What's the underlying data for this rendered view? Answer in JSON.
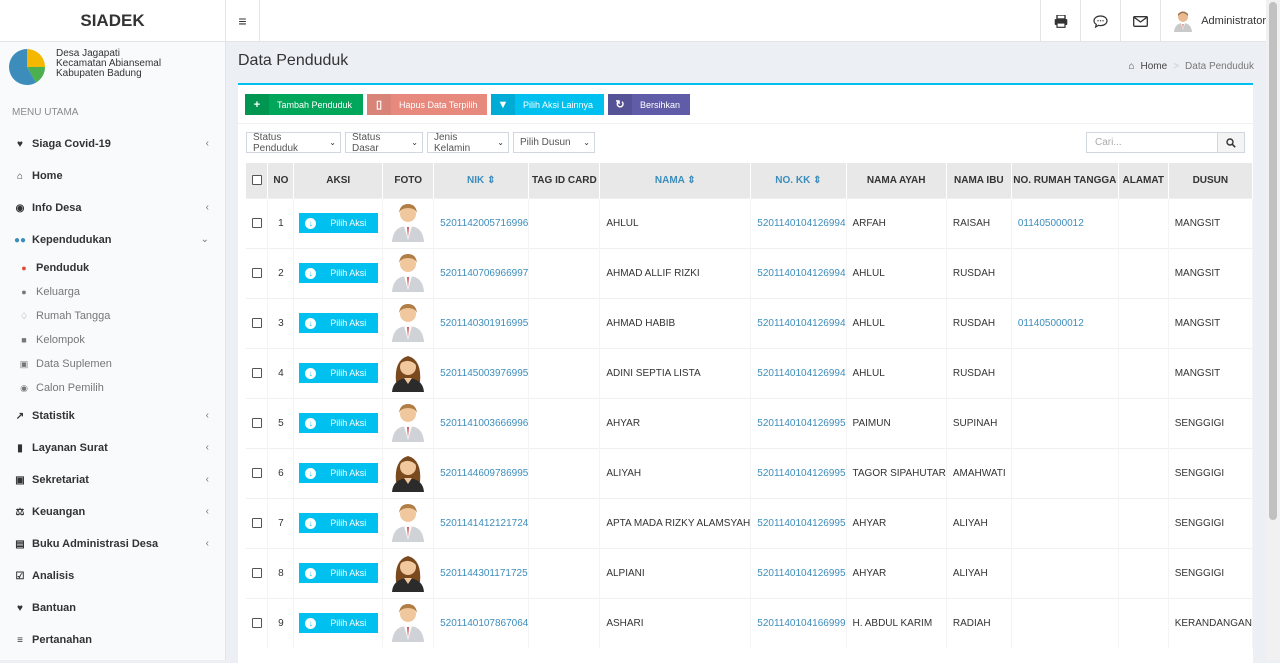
{
  "app": {
    "brand": "SIADEK",
    "user": "Administrator"
  },
  "village": {
    "name": "Desa Jagapati",
    "kecamatan": "Kecamatan Abiansemal",
    "kabupaten": "Kabupaten Badung"
  },
  "sidebar": {
    "header": "MENU UTAMA",
    "items": [
      {
        "label": "Siaga Covid-19",
        "icon": "heartbeat-icon"
      },
      {
        "label": "Home",
        "icon": "home-icon"
      },
      {
        "label": "Info Desa",
        "icon": "info-icon"
      },
      {
        "label": "Kependudukan",
        "icon": "users-icon"
      }
    ],
    "subitems": [
      {
        "label": "Penduduk",
        "icon": "user-icon"
      },
      {
        "label": "Keluarga",
        "icon": "users-icon"
      },
      {
        "label": "Rumah Tangga",
        "icon": "handshake-icon"
      },
      {
        "label": "Kelompok",
        "icon": "sitemap-icon"
      },
      {
        "label": "Data Suplemen",
        "icon": "archive-icon"
      },
      {
        "label": "Calon Pemilih",
        "icon": "vote-icon"
      }
    ],
    "items2": [
      {
        "label": "Statistik",
        "icon": "chart-icon"
      },
      {
        "label": "Layanan Surat",
        "icon": "book-icon"
      },
      {
        "label": "Sekretariat",
        "icon": "archive-icon"
      },
      {
        "label": "Keuangan",
        "icon": "balance-icon"
      },
      {
        "label": "Buku Administrasi Desa",
        "icon": "paste-icon"
      },
      {
        "label": "Analisis",
        "icon": "check-icon"
      },
      {
        "label": "Bantuan",
        "icon": "heart-icon"
      },
      {
        "label": "Pertanahan",
        "icon": "map-icon"
      }
    ]
  },
  "page": {
    "title": "Data Penduduk",
    "breadcrumb_home": "Home",
    "breadcrumb_current": "Data Penduduk"
  },
  "buttons": {
    "tambah": "Tambah Penduduk",
    "hapus": "Hapus Data Terpilih",
    "pilih_aksi_lainnya": "Pilih Aksi Lainnya",
    "bersihkan": "Bersihkan"
  },
  "filters": [
    "Status Penduduk",
    "Status Dasar",
    "Jenis Kelamin",
    "Pilih Dusun"
  ],
  "search": {
    "placeholder": "Cari..."
  },
  "table": {
    "columns": [
      "NO",
      "AKSI",
      "FOTO",
      "NIK",
      "TAG ID CARD",
      "NAMA",
      "NO. KK",
      "NAMA AYAH",
      "NAMA IBU",
      "NO. RUMAH TANGGA",
      "ALAMAT",
      "DUSUN"
    ],
    "aksi_label": "Pilih Aksi",
    "rows": [
      {
        "no": "1",
        "gender": "m",
        "nik": "5201142005716996",
        "tag": "",
        "nama": "AHLUL",
        "kk": "5201140104126994",
        "ayah": "ARFAH",
        "ibu": "RAISAH",
        "rt": "011405000012",
        "alamat": "",
        "dusun": "MANGSIT"
      },
      {
        "no": "2",
        "gender": "m",
        "nik": "5201140706966997",
        "tag": "",
        "nama": "AHMAD ALLIF RIZKI",
        "kk": "5201140104126994",
        "ayah": "AHLUL",
        "ibu": "RUSDAH",
        "rt": "",
        "alamat": "",
        "dusun": "MANGSIT"
      },
      {
        "no": "3",
        "gender": "m",
        "nik": "5201140301916995",
        "tag": "",
        "nama": "AHMAD HABIB",
        "kk": "5201140104126994",
        "ayah": "AHLUL",
        "ibu": "RUSDAH",
        "rt": "011405000012",
        "alamat": "",
        "dusun": "MANGSIT"
      },
      {
        "no": "4",
        "gender": "f",
        "nik": "5201145003976995",
        "tag": "",
        "nama": "ADINI SEPTIA LISTA",
        "kk": "5201140104126994",
        "ayah": "AHLUL",
        "ibu": "RUSDAH",
        "rt": "",
        "alamat": "",
        "dusun": "MANGSIT"
      },
      {
        "no": "5",
        "gender": "m",
        "nik": "5201141003666996",
        "tag": "",
        "nama": "AHYAR",
        "kk": "5201140104126995",
        "ayah": "PAIMUN",
        "ibu": "SUPINAH",
        "rt": "",
        "alamat": "",
        "dusun": "SENGGIGI"
      },
      {
        "no": "6",
        "gender": "f",
        "nik": "5201144609786995",
        "tag": "",
        "nama": "ALIYAH",
        "kk": "5201140104126995",
        "ayah": "TAGOR SIPAHUTAR",
        "ibu": "AMAHWATI",
        "rt": "",
        "alamat": "",
        "dusun": "SENGGIGI"
      },
      {
        "no": "7",
        "gender": "m",
        "nik": "5201141412121724",
        "tag": "",
        "nama": "APTA MADA RIZKY ALAMSYAH",
        "kk": "5201140104126995",
        "ayah": "AHYAR",
        "ibu": "ALIYAH",
        "rt": "",
        "alamat": "",
        "dusun": "SENGGIGI"
      },
      {
        "no": "8",
        "gender": "f",
        "nik": "5201144301171725",
        "tag": "",
        "nama": "ALPIANI",
        "kk": "5201140104126995",
        "ayah": "AHYAR",
        "ibu": "ALIYAH",
        "rt": "",
        "alamat": "",
        "dusun": "SENGGIGI"
      },
      {
        "no": "9",
        "gender": "m",
        "nik": "5201140107867064",
        "tag": "",
        "nama": "ASHARI",
        "kk": "5201140104166999",
        "ayah": "H. ABDUL KARIM",
        "ibu": "RADIAH",
        "rt": "",
        "alamat": "",
        "dusun": "KERANDANGAN"
      }
    ]
  }
}
